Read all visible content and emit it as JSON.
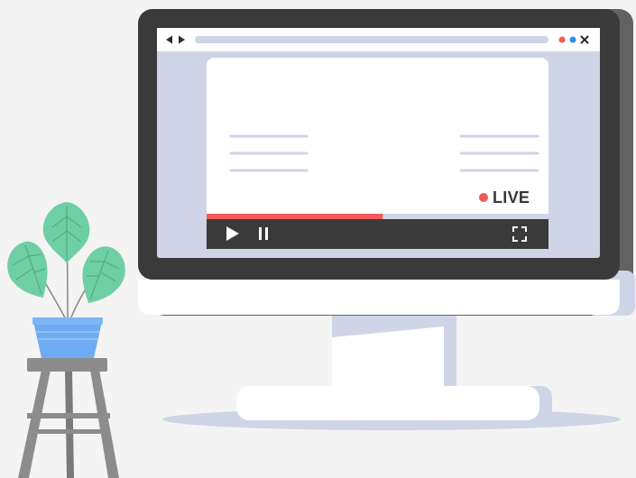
{
  "player": {
    "live_label": "LIVE",
    "progress_fraction": 0.515,
    "controls": [
      "play-icon",
      "pause-icon",
      "fullscreen-icon"
    ]
  },
  "browser": {
    "nav_icons": [
      "back-arrow-icon",
      "forward-arrow-icon"
    ],
    "window_icons": [
      "red-dot-icon",
      "blue-dot-icon",
      "close-icon"
    ]
  },
  "colors": {
    "background": "#f4f4f4",
    "monitor_frame": "#3a3a3a",
    "monitor_side": "#626262",
    "screen_bg": "#cfd5e7",
    "live_red": "#f25a5a",
    "dot_blue": "#2f8ef0",
    "leaf_green": "#6fcfa4",
    "pot_blue": "#6eabf2",
    "stool_gray": "#8c8c8c"
  }
}
